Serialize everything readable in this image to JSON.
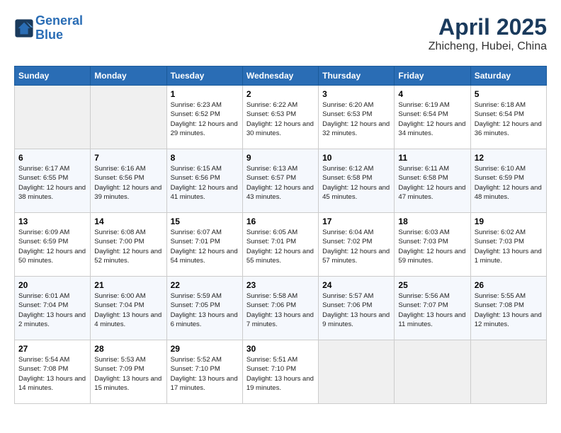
{
  "header": {
    "logo_line1": "General",
    "logo_line2": "Blue",
    "month": "April 2025",
    "location": "Zhicheng, Hubei, China"
  },
  "weekdays": [
    "Sunday",
    "Monday",
    "Tuesday",
    "Wednesday",
    "Thursday",
    "Friday",
    "Saturday"
  ],
  "weeks": [
    [
      {
        "day": "",
        "sunrise": "",
        "sunset": "",
        "daylight": "",
        "empty": true
      },
      {
        "day": "",
        "sunrise": "",
        "sunset": "",
        "daylight": "",
        "empty": true
      },
      {
        "day": "1",
        "sunrise": "Sunrise: 6:23 AM",
        "sunset": "Sunset: 6:52 PM",
        "daylight": "Daylight: 12 hours and 29 minutes."
      },
      {
        "day": "2",
        "sunrise": "Sunrise: 6:22 AM",
        "sunset": "Sunset: 6:53 PM",
        "daylight": "Daylight: 12 hours and 30 minutes."
      },
      {
        "day": "3",
        "sunrise": "Sunrise: 6:20 AM",
        "sunset": "Sunset: 6:53 PM",
        "daylight": "Daylight: 12 hours and 32 minutes."
      },
      {
        "day": "4",
        "sunrise": "Sunrise: 6:19 AM",
        "sunset": "Sunset: 6:54 PM",
        "daylight": "Daylight: 12 hours and 34 minutes."
      },
      {
        "day": "5",
        "sunrise": "Sunrise: 6:18 AM",
        "sunset": "Sunset: 6:54 PM",
        "daylight": "Daylight: 12 hours and 36 minutes."
      }
    ],
    [
      {
        "day": "6",
        "sunrise": "Sunrise: 6:17 AM",
        "sunset": "Sunset: 6:55 PM",
        "daylight": "Daylight: 12 hours and 38 minutes."
      },
      {
        "day": "7",
        "sunrise": "Sunrise: 6:16 AM",
        "sunset": "Sunset: 6:56 PM",
        "daylight": "Daylight: 12 hours and 39 minutes."
      },
      {
        "day": "8",
        "sunrise": "Sunrise: 6:15 AM",
        "sunset": "Sunset: 6:56 PM",
        "daylight": "Daylight: 12 hours and 41 minutes."
      },
      {
        "day": "9",
        "sunrise": "Sunrise: 6:13 AM",
        "sunset": "Sunset: 6:57 PM",
        "daylight": "Daylight: 12 hours and 43 minutes."
      },
      {
        "day": "10",
        "sunrise": "Sunrise: 6:12 AM",
        "sunset": "Sunset: 6:58 PM",
        "daylight": "Daylight: 12 hours and 45 minutes."
      },
      {
        "day": "11",
        "sunrise": "Sunrise: 6:11 AM",
        "sunset": "Sunset: 6:58 PM",
        "daylight": "Daylight: 12 hours and 47 minutes."
      },
      {
        "day": "12",
        "sunrise": "Sunrise: 6:10 AM",
        "sunset": "Sunset: 6:59 PM",
        "daylight": "Daylight: 12 hours and 48 minutes."
      }
    ],
    [
      {
        "day": "13",
        "sunrise": "Sunrise: 6:09 AM",
        "sunset": "Sunset: 6:59 PM",
        "daylight": "Daylight: 12 hours and 50 minutes."
      },
      {
        "day": "14",
        "sunrise": "Sunrise: 6:08 AM",
        "sunset": "Sunset: 7:00 PM",
        "daylight": "Daylight: 12 hours and 52 minutes."
      },
      {
        "day": "15",
        "sunrise": "Sunrise: 6:07 AM",
        "sunset": "Sunset: 7:01 PM",
        "daylight": "Daylight: 12 hours and 54 minutes."
      },
      {
        "day": "16",
        "sunrise": "Sunrise: 6:05 AM",
        "sunset": "Sunset: 7:01 PM",
        "daylight": "Daylight: 12 hours and 55 minutes."
      },
      {
        "day": "17",
        "sunrise": "Sunrise: 6:04 AM",
        "sunset": "Sunset: 7:02 PM",
        "daylight": "Daylight: 12 hours and 57 minutes."
      },
      {
        "day": "18",
        "sunrise": "Sunrise: 6:03 AM",
        "sunset": "Sunset: 7:03 PM",
        "daylight": "Daylight: 12 hours and 59 minutes."
      },
      {
        "day": "19",
        "sunrise": "Sunrise: 6:02 AM",
        "sunset": "Sunset: 7:03 PM",
        "daylight": "Daylight: 13 hours and 1 minute."
      }
    ],
    [
      {
        "day": "20",
        "sunrise": "Sunrise: 6:01 AM",
        "sunset": "Sunset: 7:04 PM",
        "daylight": "Daylight: 13 hours and 2 minutes."
      },
      {
        "day": "21",
        "sunrise": "Sunrise: 6:00 AM",
        "sunset": "Sunset: 7:04 PM",
        "daylight": "Daylight: 13 hours and 4 minutes."
      },
      {
        "day": "22",
        "sunrise": "Sunrise: 5:59 AM",
        "sunset": "Sunset: 7:05 PM",
        "daylight": "Daylight: 13 hours and 6 minutes."
      },
      {
        "day": "23",
        "sunrise": "Sunrise: 5:58 AM",
        "sunset": "Sunset: 7:06 PM",
        "daylight": "Daylight: 13 hours and 7 minutes."
      },
      {
        "day": "24",
        "sunrise": "Sunrise: 5:57 AM",
        "sunset": "Sunset: 7:06 PM",
        "daylight": "Daylight: 13 hours and 9 minutes."
      },
      {
        "day": "25",
        "sunrise": "Sunrise: 5:56 AM",
        "sunset": "Sunset: 7:07 PM",
        "daylight": "Daylight: 13 hours and 11 minutes."
      },
      {
        "day": "26",
        "sunrise": "Sunrise: 5:55 AM",
        "sunset": "Sunset: 7:08 PM",
        "daylight": "Daylight: 13 hours and 12 minutes."
      }
    ],
    [
      {
        "day": "27",
        "sunrise": "Sunrise: 5:54 AM",
        "sunset": "Sunset: 7:08 PM",
        "daylight": "Daylight: 13 hours and 14 minutes."
      },
      {
        "day": "28",
        "sunrise": "Sunrise: 5:53 AM",
        "sunset": "Sunset: 7:09 PM",
        "daylight": "Daylight: 13 hours and 15 minutes."
      },
      {
        "day": "29",
        "sunrise": "Sunrise: 5:52 AM",
        "sunset": "Sunset: 7:10 PM",
        "daylight": "Daylight: 13 hours and 17 minutes."
      },
      {
        "day": "30",
        "sunrise": "Sunrise: 5:51 AM",
        "sunset": "Sunset: 7:10 PM",
        "daylight": "Daylight: 13 hours and 19 minutes."
      },
      {
        "day": "",
        "sunrise": "",
        "sunset": "",
        "daylight": "",
        "empty": true
      },
      {
        "day": "",
        "sunrise": "",
        "sunset": "",
        "daylight": "",
        "empty": true
      },
      {
        "day": "",
        "sunrise": "",
        "sunset": "",
        "daylight": "",
        "empty": true
      }
    ]
  ]
}
